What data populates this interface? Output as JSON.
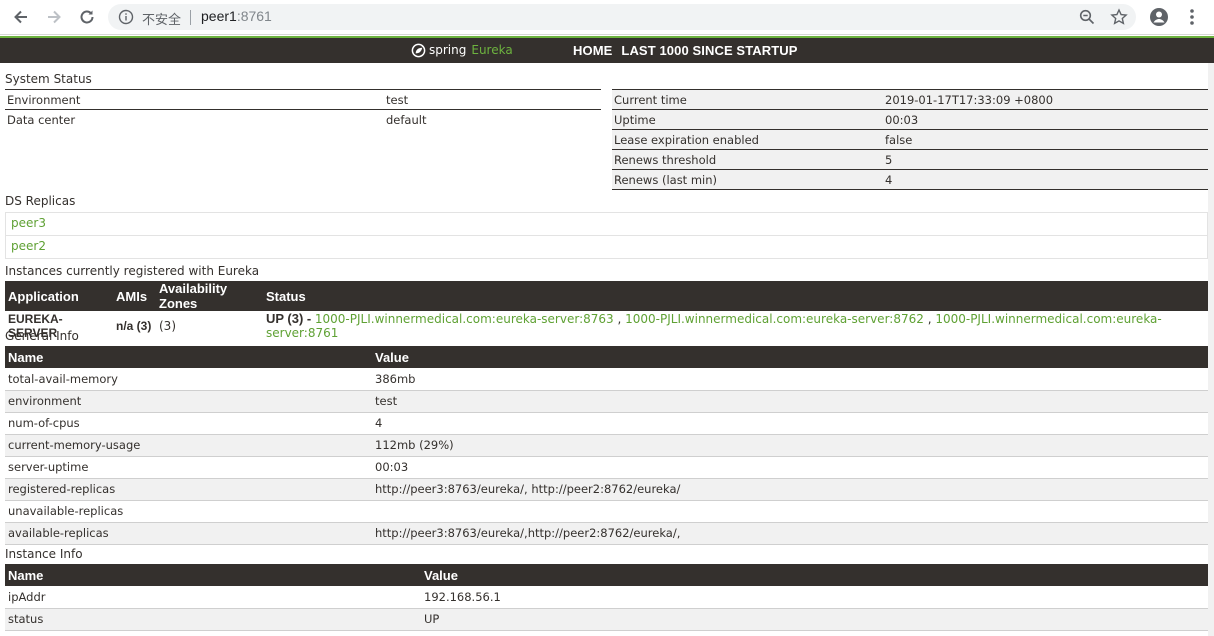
{
  "browser": {
    "insecure_label": "不安全",
    "host": "peer1",
    "port": ":8761"
  },
  "navbar": {
    "brand_word": "spring",
    "brand_eureka": "Eureka",
    "links": [
      "HOME",
      "LAST 1000 SINCE STARTUP"
    ]
  },
  "system_status": {
    "title": "System Status",
    "left": [
      {
        "label": "Environment",
        "value": "test"
      },
      {
        "label": "Data center",
        "value": "default"
      }
    ],
    "right": [
      {
        "label": "Current time",
        "value": "2019-01-17T17:33:09 +0800"
      },
      {
        "label": "Uptime",
        "value": "00:03"
      },
      {
        "label": "Lease expiration enabled",
        "value": "false"
      },
      {
        "label": "Renews threshold",
        "value": "5"
      },
      {
        "label": "Renews (last min)",
        "value": "4"
      }
    ]
  },
  "ds_replicas": {
    "title": "DS Replicas",
    "items": [
      "peer3",
      "peer2"
    ]
  },
  "instances": {
    "title": "Instances currently registered with Eureka",
    "headers": [
      "Application",
      "AMIs",
      "Availability Zones",
      "Status"
    ],
    "rows": [
      {
        "application": "EUREKA-SERVER",
        "amis": "n/a (3)",
        "zones": "(3)",
        "status_up": "UP (3) - ",
        "links": [
          "1000-PJLI.winnermedical.com:eureka-server:8763",
          "1000-PJLI.winnermedical.com:eureka-server:8762",
          "1000-PJLI.winnermedical.com:eureka-server:8761"
        ],
        "link_sep": " , "
      }
    ]
  },
  "general_info": {
    "title": "General Info",
    "headers": [
      "Name",
      "Value"
    ],
    "rows": [
      {
        "name": "total-avail-memory",
        "value": "386mb"
      },
      {
        "name": "environment",
        "value": "test"
      },
      {
        "name": "num-of-cpus",
        "value": "4"
      },
      {
        "name": "current-memory-usage",
        "value": "112mb (29%)"
      },
      {
        "name": "server-uptime",
        "value": "00:03"
      },
      {
        "name": "registered-replicas",
        "value": "http://peer3:8763/eureka/, http://peer2:8762/eureka/"
      },
      {
        "name": "unavailable-replicas",
        "value": ""
      },
      {
        "name": "available-replicas",
        "value": "http://peer3:8763/eureka/,http://peer2:8762/eureka/,"
      }
    ]
  },
  "instance_info": {
    "title": "Instance Info",
    "headers": [
      "Name",
      "Value"
    ],
    "rows": [
      {
        "name": "ipAddr",
        "value": "192.168.56.1"
      },
      {
        "name": "status",
        "value": "UP"
      }
    ]
  },
  "colors": {
    "spring_green": "#6db33f",
    "link_green": "#5fa134",
    "header_dark": "#34302d"
  }
}
